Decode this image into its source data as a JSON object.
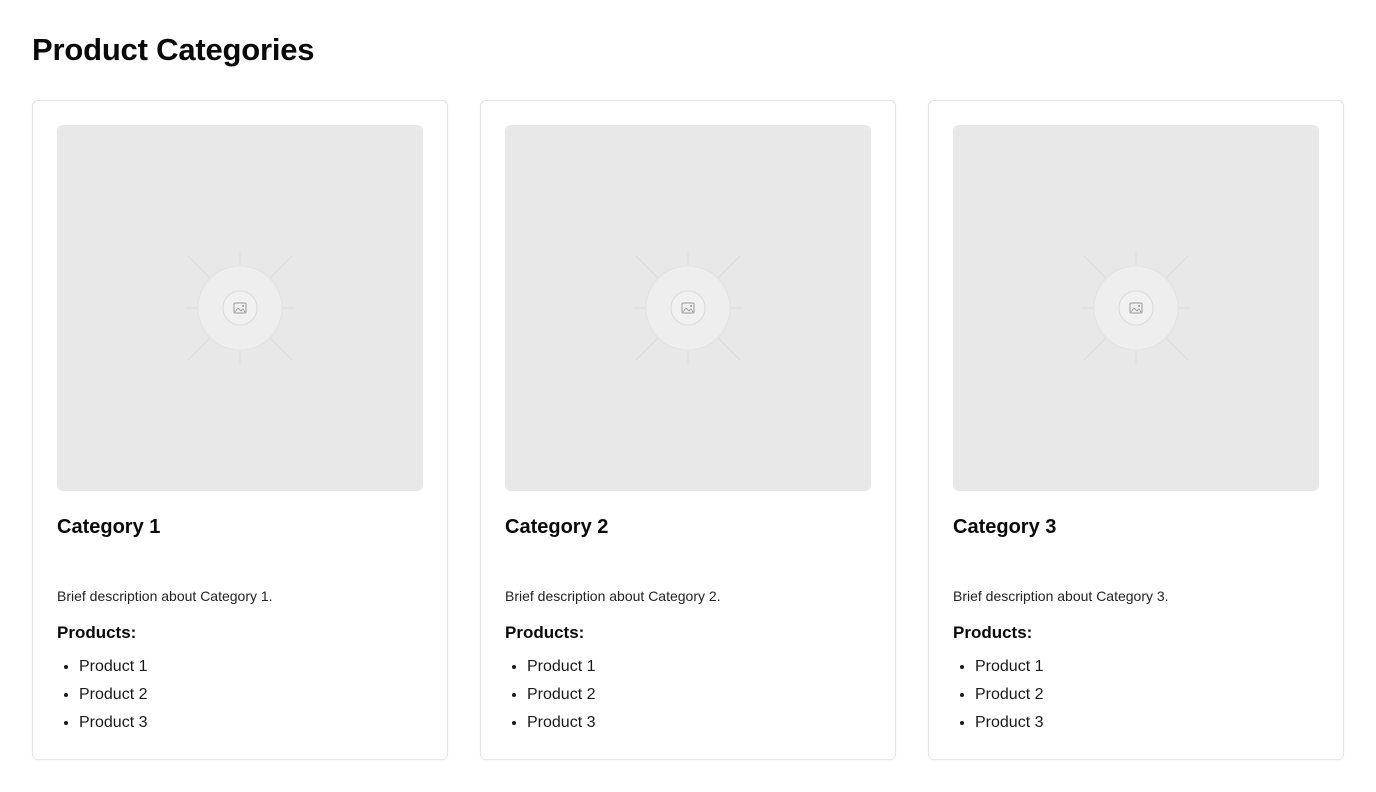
{
  "page": {
    "title": "Product Categories"
  },
  "theme": {
    "background": "#ffffff",
    "card_border": "#e5e5e5",
    "placeholder_bg": "#e8e8e8",
    "text": "#0a0a0a"
  },
  "cards": [
    {
      "image_icon": "image-placeholder-icon",
      "title": "Category 1",
      "description": "Brief description about Category 1.",
      "products_heading": "Products:",
      "products": [
        "Product 1",
        "Product 2",
        "Product 3"
      ]
    },
    {
      "image_icon": "image-placeholder-icon",
      "title": "Category 2",
      "description": "Brief description about Category 2.",
      "products_heading": "Products:",
      "products": [
        "Product 1",
        "Product 2",
        "Product 3"
      ]
    },
    {
      "image_icon": "image-placeholder-icon",
      "title": "Category 3",
      "description": "Brief description about Category 3.",
      "products_heading": "Products:",
      "products": [
        "Product 1",
        "Product 2",
        "Product 3"
      ]
    }
  ]
}
